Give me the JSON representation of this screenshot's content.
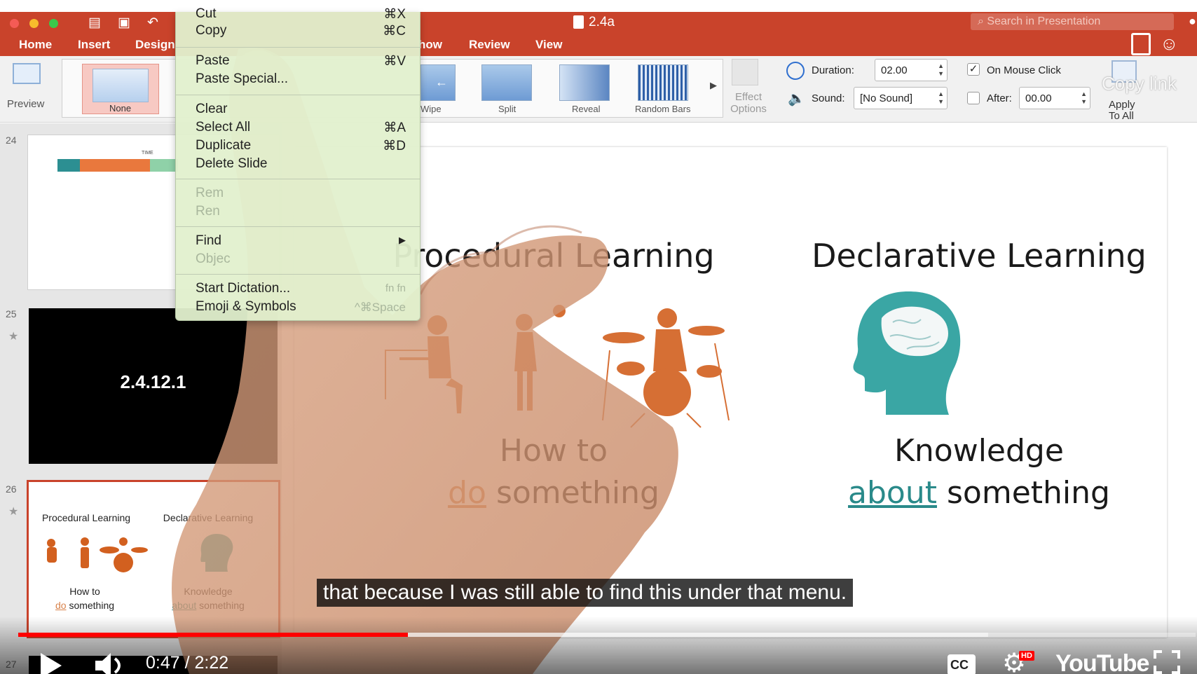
{
  "window": {
    "title": "2.4a",
    "search_placeholder": "Search in Presentation"
  },
  "tabs": [
    "Home",
    "Insert",
    "Design",
    "how",
    "Review",
    "View"
  ],
  "ribbon": {
    "preview_label": "Preview",
    "transitions": [
      "None",
      "Wipe",
      "Split",
      "Reveal",
      "Random Bars"
    ],
    "effect_options_label": "Effect Options",
    "duration_label": "Duration:",
    "duration_value": "02.00",
    "sound_label": "Sound:",
    "sound_value": "[No Sound]",
    "on_mouse_click_label": "On Mouse Click",
    "on_mouse_click_checked": true,
    "after_label": "After:",
    "after_value": "00.00",
    "after_checked": false,
    "apply_to_all_label": "Apply To All",
    "copy_link_label": "Copy link"
  },
  "context_menu": {
    "items": [
      {
        "label": "Cut",
        "shortcut": "⌘X"
      },
      {
        "label": "Copy",
        "shortcut": "⌘C"
      },
      {
        "label": "Paste",
        "shortcut": "⌘V"
      },
      {
        "label": "Paste Special...",
        "shortcut": ""
      },
      {
        "label": "Clear",
        "shortcut": ""
      },
      {
        "label": "Select All",
        "shortcut": "⌘A"
      },
      {
        "label": "Duplicate",
        "shortcut": "⌘D"
      },
      {
        "label": "Delete Slide",
        "shortcut": ""
      },
      {
        "label": "Rem",
        "shortcut": ""
      },
      {
        "label": "Ren",
        "shortcut": ""
      },
      {
        "label": "Find",
        "shortcut": "▶"
      },
      {
        "label": "Objec",
        "shortcut": ""
      },
      {
        "label": "Start Dictation...",
        "shortcut": "fn fn"
      },
      {
        "label": "Emoji & Symbols",
        "shortcut": "^⌘Space"
      }
    ]
  },
  "slides_panel": {
    "slides": [
      {
        "number": "24",
        "timeline_label": "TIME"
      },
      {
        "number": "25",
        "text": "2.4.12.1"
      },
      {
        "number": "26",
        "left_title": "Procedural Learning",
        "right_title": "Declarative Learning",
        "left_caption_1": "How to",
        "left_caption_hl": "do",
        "left_caption_2": "something",
        "right_caption_1": "Knowledge",
        "right_caption_hl": "about",
        "right_caption_2": "something"
      },
      {
        "number": "27"
      }
    ]
  },
  "main_slide": {
    "left_title": "Procedural Learning",
    "right_title": "Declarative Learning",
    "left_caption_line1": "How to",
    "left_caption_highlight": "do",
    "left_caption_rest": "something",
    "right_caption_line1": "Knowledge",
    "right_caption_highlight": "about",
    "right_caption_rest": "something",
    "colors": {
      "orange": "#d2601f",
      "teal": "#3aa6a4",
      "highlight_orange": "#d8824a",
      "highlight_teal": "#2a8a8a"
    }
  },
  "video_player": {
    "subtitle": "that because I was still able to find this under that menu.",
    "current_time": "0:47",
    "duration": "2:22",
    "time_display": "0:47 / 2:22",
    "progress": 0.331,
    "buffered": 0.824,
    "quality_badge": "HD",
    "logo_text": "YouTube",
    "cc_label": "CC"
  }
}
